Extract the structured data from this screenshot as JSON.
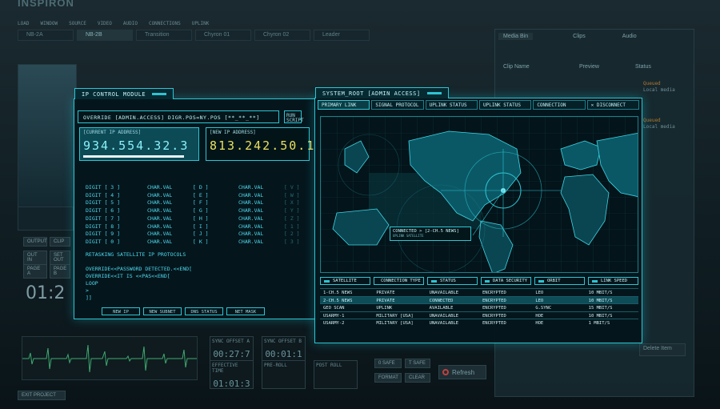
{
  "app": {
    "title": "INSPIRON",
    "menu": [
      "LOAD",
      "WINDOW",
      "SOURCE",
      "VIDEO",
      "AUDIO",
      "CONNECTIONS",
      "UPLINK"
    ],
    "tabs": [
      "NB-2A",
      "NB-2B",
      "Transition",
      "Chyron 01",
      "Chyron 02",
      "Leader"
    ],
    "right_tabs": [
      "Media Bin",
      "Clips",
      "Audio"
    ],
    "right_columns": [
      "Clip Name",
      "Preview",
      "Status"
    ],
    "right_status": [
      "Queued",
      "Local media",
      "Queued",
      "Local media"
    ],
    "left_buttons": [
      "OUTPUT",
      "CLIP",
      "OUT IN",
      "SET OUT",
      "PAGE A",
      "PAGE B"
    ],
    "clock": "01:2",
    "timecodes": [
      {
        "label": "SYNC OFFSET A",
        "value": "00:27:7"
      },
      {
        "label": "SYNC OFFSET B",
        "value": "00:01:1"
      },
      {
        "label": "EFFECTIVE TIME",
        "value": "01:01:3"
      },
      {
        "label": "PRE-ROLL",
        "value": ""
      },
      {
        "label": "POST ROLL",
        "value": ""
      }
    ],
    "bottom_buttons": [
      "0 SAFE",
      "T SAFE",
      "FORMAT",
      "CLEAR"
    ],
    "refresh_label": "Refresh",
    "delete_label": "Delete Item",
    "exit_label": "EXIT PROJECT"
  },
  "ip_module": {
    "title": "IP CONTROL MODULE",
    "command": "OVERRIDE [ADMIN.ACCESS] DIGR.POS=NY.POS [**_**_**]",
    "run_label": "RUN SCRIPT",
    "current_label": "[CURRENT IP ADDRESS]",
    "current_value": "934.554.32.3",
    "new_label": "[NEW IP ADDRESS]",
    "new_value": "813.242.50.1",
    "digits": [
      {
        "digit": "DIGIT [ 3 ]",
        "cv1": "CHAR.VAL",
        "ch1": "[ D ]",
        "cv2": "CHAR.VAL",
        "ch2": "[ V ]"
      },
      {
        "digit": "DIGIT [ 4 ]",
        "cv1": "CHAR.VAL",
        "ch1": "[ E ]",
        "cv2": "CHAR.VAL",
        "ch2": "[ W ]"
      },
      {
        "digit": "DIGIT [ 5 ]",
        "cv1": "CHAR.VAL",
        "ch1": "[ F ]",
        "cv2": "CHAR.VAL",
        "ch2": "[ X ]"
      },
      {
        "digit": "DIGIT [ 6 ]",
        "cv1": "CHAR.VAL",
        "ch1": "[ G ]",
        "cv2": "CHAR.VAL",
        "ch2": "[ Y ]"
      },
      {
        "digit": "DIGIT [ 7 ]",
        "cv1": "CHAR.VAL",
        "ch1": "[ H ]",
        "cv2": "CHAR.VAL",
        "ch2": "[ Z ]"
      },
      {
        "digit": "DIGIT [ 8 ]",
        "cv1": "CHAR.VAL",
        "ch1": "[ I ]",
        "cv2": "CHAR.VAL",
        "ch2": "[ 1 ]"
      },
      {
        "digit": "DIGIT [ 9 ]",
        "cv1": "CHAR.VAL",
        "ch1": "[ J ]",
        "cv2": "CHAR.VAL",
        "ch2": "[ 2 ]"
      },
      {
        "digit": "DIGIT [ 0 ]",
        "cv1": "CHAR.VAL",
        "ch1": "[ K ]",
        "cv2": "CHAR.VAL",
        "ch2": "[ 3 ]"
      }
    ],
    "terminal": [
      "RETASKING SATELLITE IP PROTOCOLS",
      "",
      "OVERRIDE<<PASSWORD DETECTED.<<END[",
      "OVERRIDE<<IT IS <<PAS<<END[",
      "LOOP",
      ">",
      " ]]"
    ],
    "footer_buttons": [
      "NEW IP",
      "NEW SUBNET",
      "DNS STATUS",
      "NET MASK"
    ]
  },
  "system_root": {
    "title": "SYSTEM_ROOT [ADMIN ACCESS]",
    "tabs": [
      "PRIMARY LINK",
      "SIGNAL PROTOCOL",
      "UPLINK STATUS",
      "UPLINK STATUS",
      "CONNECTION",
      "DISCONNECT"
    ],
    "connected_label": "CONNECTED > [2-CH.5 NEWS]",
    "connected_sub": "UPLINK SATELLITE",
    "columns": [
      "SATELLITE",
      "CONNECTION TYPE",
      "STATUS",
      "DATA SECURITY",
      "ORBIT",
      "LINK SPEED"
    ],
    "rows": [
      [
        "1-CH.5 NEWS",
        "PRIVATE",
        "UNAVAILABLE",
        "ENCRYPTED",
        "LEO",
        "10 MBIT/S"
      ],
      [
        "2-CH.5 NEWS",
        "PRIVATE",
        "CONNECTED",
        "ENCRYPTED",
        "LEO",
        "10 MBIT/S"
      ],
      [
        "GEO SCAN",
        "UPLINK",
        "AVAILABLE",
        "ENCRYPTED",
        "G.SYNC",
        "15 MBIT/S"
      ],
      [
        "USARMY-1",
        "MILITARY [USA]",
        "UNAVAILABLE",
        "ENCRYPTED",
        "HOE",
        "10 MBIT/S"
      ],
      [
        "USARMY-2",
        "MILITARY [USA]",
        "UNAVAILABLE",
        "ENCRYPTED",
        "HOE",
        "1 MBIT/S"
      ]
    ],
    "highlight_row": 1
  },
  "colors": {
    "accent": "#2ec4d2",
    "current_ip": "#6ee8f2",
    "new_ip": "#e8e060"
  }
}
